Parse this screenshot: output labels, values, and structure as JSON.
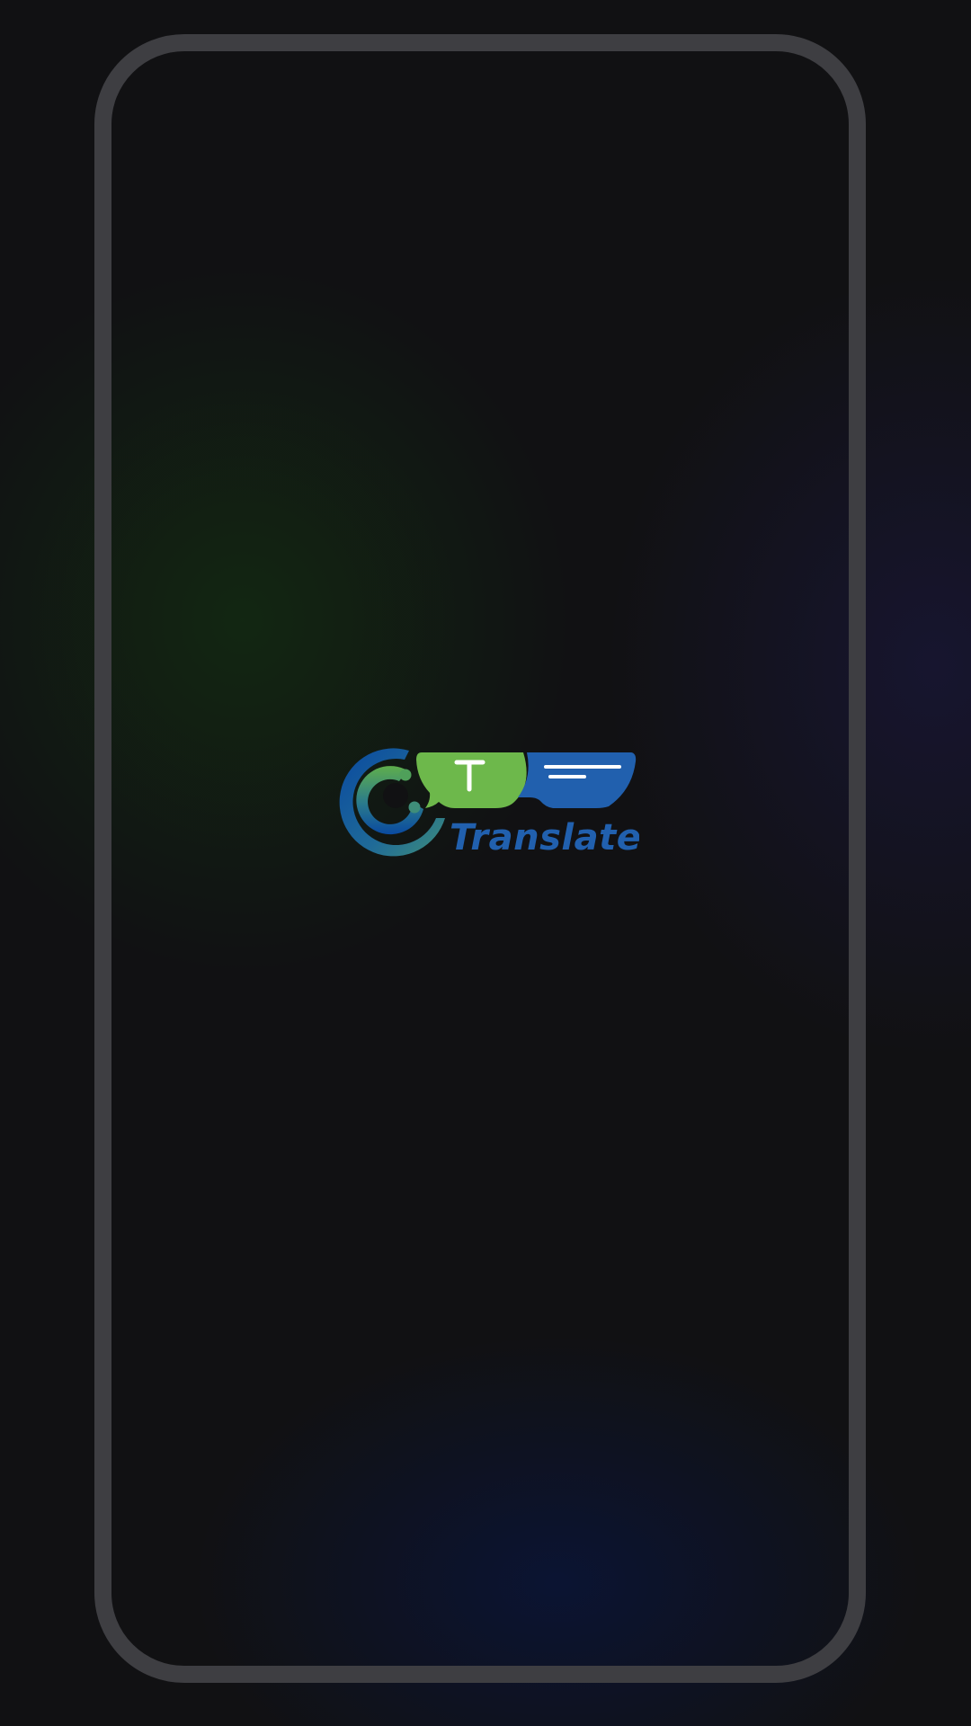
{
  "app": {
    "logo": {
      "wordmark": "Translate",
      "badge_letter": "T",
      "icon_name": "ct-translate-logo-icon"
    }
  },
  "colors": {
    "background": "#111113",
    "frame": "#3e3e42",
    "brand_green": "#6db84b",
    "brand_blue": "#2160ae",
    "brand_blue_dark": "#0a4aa0"
  }
}
